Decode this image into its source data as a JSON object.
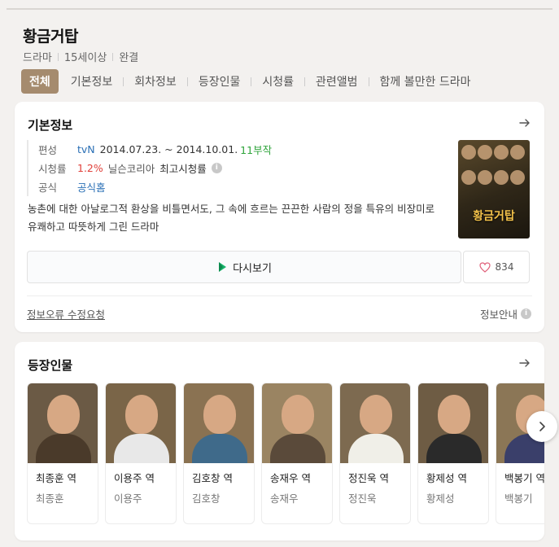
{
  "header": {
    "title": "황금거탑",
    "meta": [
      "드라마",
      "15세이상",
      "완결"
    ]
  },
  "tabs": [
    "전체",
    "기본정보",
    "회차정보",
    "등장인물",
    "시청률",
    "관련앨범",
    "함께 볼만한 드라마"
  ],
  "basic_info": {
    "title": "기본정보",
    "rows": {
      "broadcast_label": "편성",
      "channel": "tvN",
      "period": "2014.07.23. ~ 2014.10.01.",
      "episodes": "11부작",
      "rating_label": "시청률",
      "rating_value": "1.2%",
      "rating_source": "닐슨코리아",
      "rating_type": "최고시청률",
      "official_label": "공식",
      "official_link": "공식홈"
    },
    "description": "농촌에 대한 아날로그적 환상을 비틀면서도, 그 속에 흐르는 끈끈한 사람의 정을 특유의 비장미로 유쾌하고 따뜻하게 그린 드라마",
    "poster_title": "황금거탑",
    "watch_label": "다시보기",
    "like_count": "834",
    "report_label": "정보오류 수정요청",
    "guide_label": "정보안내"
  },
  "cast_section": {
    "title": "등장인물",
    "members": [
      {
        "role": "최종훈 역",
        "actor": "최종훈",
        "bg": "#6b5a45",
        "cloth": "#4a3a2a"
      },
      {
        "role": "이용주 역",
        "actor": "이용주",
        "bg": "#7a6548",
        "cloth": "#e8e8e8"
      },
      {
        "role": "김호창 역",
        "actor": "김호창",
        "bg": "#8a7252",
        "cloth": "#3f6a8a"
      },
      {
        "role": "송재우 역",
        "actor": "송재우",
        "bg": "#9a8462",
        "cloth": "#5a4a3a"
      },
      {
        "role": "정진욱 역",
        "actor": "정진욱",
        "bg": "#7d6a50",
        "cloth": "#f0efe8"
      },
      {
        "role": "황제성 역",
        "actor": "황제성",
        "bg": "#6e5c44",
        "cloth": "#2a2a2a"
      },
      {
        "role": "백봉기 역",
        "actor": "백봉기",
        "bg": "#8b7656",
        "cloth": "#3a3f6a"
      }
    ]
  },
  "colors": {
    "accent": "#a58b6e",
    "link": "#2a6fb5",
    "rating": "#e0403a",
    "episodes": "#2fa43b"
  }
}
